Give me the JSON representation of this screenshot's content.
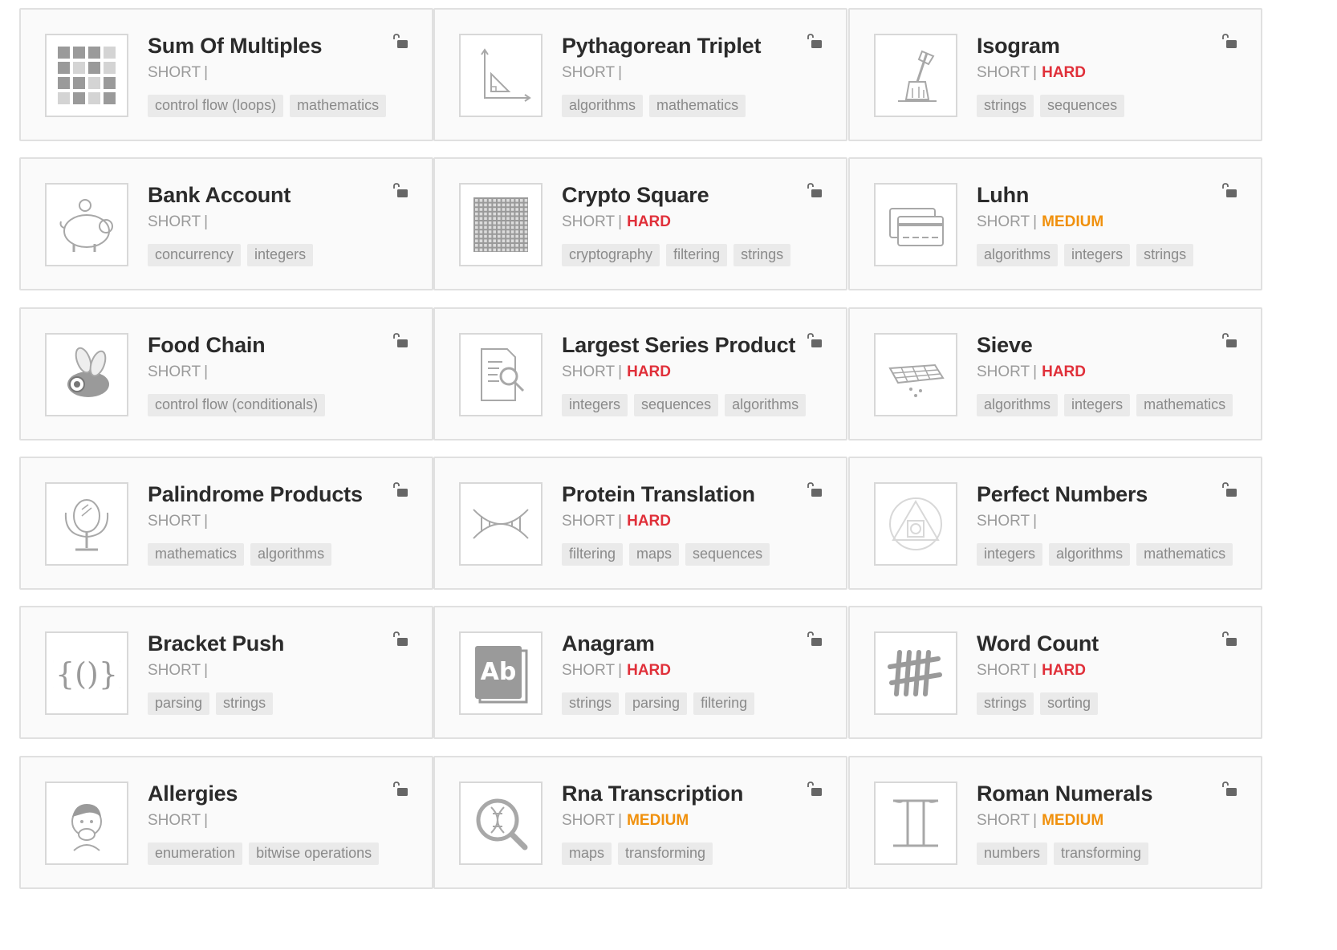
{
  "exercises": [
    {
      "title": "Sum Of Multiples",
      "length": "SHORT",
      "difficulty": "",
      "difficulty_level": "",
      "tags": [
        "control flow (loops)",
        "mathematics"
      ],
      "icon": "multiples-grid-icon"
    },
    {
      "title": "Pythagorean Triplet",
      "length": "SHORT",
      "difficulty": "",
      "difficulty_level": "",
      "tags": [
        "algorithms",
        "mathematics"
      ],
      "icon": "triangle-icon"
    },
    {
      "title": "Isogram",
      "length": "SHORT",
      "difficulty": "HARD",
      "difficulty_level": "hard",
      "tags": [
        "strings",
        "sequences"
      ],
      "icon": "axe-stump-icon"
    },
    {
      "title": "Bank Account",
      "length": "SHORT",
      "difficulty": "",
      "difficulty_level": "",
      "tags": [
        "concurrency",
        "integers"
      ],
      "icon": "piggy-bank-icon"
    },
    {
      "title": "Crypto Square",
      "length": "SHORT",
      "difficulty": "HARD",
      "difficulty_level": "hard",
      "tags": [
        "cryptography",
        "filtering",
        "strings"
      ],
      "icon": "dot-grid-icon"
    },
    {
      "title": "Luhn",
      "length": "SHORT",
      "difficulty": "MEDIUM",
      "difficulty_level": "medium",
      "tags": [
        "algorithms",
        "integers",
        "strings"
      ],
      "icon": "credit-cards-icon"
    },
    {
      "title": "Food Chain",
      "length": "SHORT",
      "difficulty": "",
      "difficulty_level": "",
      "tags": [
        "control flow (conditionals)"
      ],
      "icon": "fly-icon"
    },
    {
      "title": "Largest Series Product",
      "length": "SHORT",
      "difficulty": "HARD",
      "difficulty_level": "hard",
      "tags": [
        "integers",
        "sequences",
        "algorithms"
      ],
      "icon": "document-search-icon"
    },
    {
      "title": "Sieve",
      "length": "SHORT",
      "difficulty": "HARD",
      "difficulty_level": "hard",
      "tags": [
        "algorithms",
        "integers",
        "mathematics"
      ],
      "icon": "sieve-icon"
    },
    {
      "title": "Palindrome Products",
      "length": "SHORT",
      "difficulty": "",
      "difficulty_level": "",
      "tags": [
        "mathematics",
        "algorithms"
      ],
      "icon": "mirror-icon"
    },
    {
      "title": "Protein Translation",
      "length": "SHORT",
      "difficulty": "HARD",
      "difficulty_level": "hard",
      "tags": [
        "filtering",
        "maps",
        "sequences"
      ],
      "icon": "dna-icon"
    },
    {
      "title": "Perfect Numbers",
      "length": "SHORT",
      "difficulty": "",
      "difficulty_level": "",
      "tags": [
        "integers",
        "algorithms",
        "mathematics"
      ],
      "icon": "circle-triangle-icon"
    },
    {
      "title": "Bracket Push",
      "length": "SHORT",
      "difficulty": "",
      "difficulty_level": "",
      "tags": [
        "parsing",
        "strings"
      ],
      "icon": "brackets-icon"
    },
    {
      "title": "Anagram",
      "length": "SHORT",
      "difficulty": "HARD",
      "difficulty_level": "hard",
      "tags": [
        "strings",
        "parsing",
        "filtering"
      ],
      "icon": "ab-book-icon"
    },
    {
      "title": "Word Count",
      "length": "SHORT",
      "difficulty": "HARD",
      "difficulty_level": "hard",
      "tags": [
        "strings",
        "sorting"
      ],
      "icon": "tally-marks-icon"
    },
    {
      "title": "Allergies",
      "length": "SHORT",
      "difficulty": "",
      "difficulty_level": "",
      "tags": [
        "enumeration",
        "bitwise operations"
      ],
      "icon": "sneezing-person-icon"
    },
    {
      "title": "Rna Transcription",
      "length": "SHORT",
      "difficulty": "MEDIUM",
      "difficulty_level": "medium",
      "tags": [
        "maps",
        "transforming"
      ],
      "icon": "dna-magnifier-icon"
    },
    {
      "title": "Roman Numerals",
      "length": "SHORT",
      "difficulty": "MEDIUM",
      "difficulty_level": "medium",
      "tags": [
        "numbers",
        "transforming"
      ],
      "icon": "roman-two-icon"
    }
  ],
  "separator": "|",
  "colors": {
    "hard": "#e0303a",
    "medium": "#f0900c",
    "tag_bg": "#eaeaea",
    "icon_stroke": "#a8a8a8"
  }
}
